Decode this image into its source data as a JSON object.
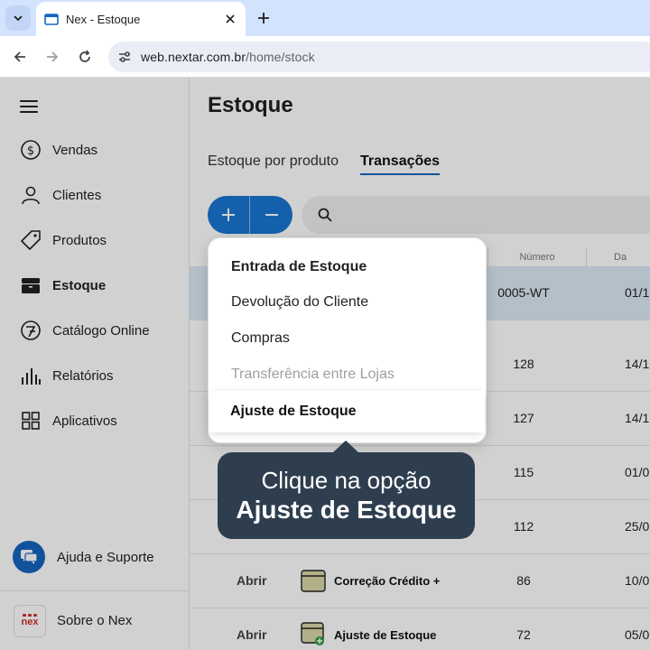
{
  "browser": {
    "tab_title": "Nex - Estoque",
    "url_host": "web.nextar.com.br",
    "url_path": "/home/stock",
    "icons": {
      "dropdown": "chevron-down-icon",
      "favicon": "nex-favicon-icon",
      "close": "close-icon",
      "newtab": "plus-icon",
      "back": "arrow-left-icon",
      "forward": "arrow-right-icon",
      "reload": "reload-icon",
      "siteinfo": "tune-icon"
    }
  },
  "sidebar": {
    "items": [
      {
        "label": "Vendas",
        "icon": "dollar-circle-icon"
      },
      {
        "label": "Clientes",
        "icon": "person-icon"
      },
      {
        "label": "Produtos",
        "icon": "tag-icon"
      },
      {
        "label": "Estoque",
        "icon": "box-icon",
        "active": true
      },
      {
        "label": "Catálogo Online",
        "icon": "catalog-icon"
      },
      {
        "label": "Relatórios",
        "icon": "bar-chart-icon"
      },
      {
        "label": "Aplicativos",
        "icon": "apps-grid-icon"
      }
    ],
    "help_label": "Ajuda e Suporte",
    "about_label": "Sobre o Nex",
    "logo_text": "nex"
  },
  "main": {
    "title": "Estoque",
    "tabs": [
      {
        "label": "Estoque por produto",
        "active": false
      },
      {
        "label": "Transações",
        "active": true
      }
    ],
    "table": {
      "headers": {
        "number": "Número",
        "date": "Da"
      },
      "rows": [
        {
          "open": "",
          "type": "",
          "number": "0005-WT",
          "date": "01/1",
          "highlight": true
        },
        {
          "open": "",
          "type": "",
          "number": "128",
          "date": "14/1"
        },
        {
          "open": "",
          "type": "",
          "number": "127",
          "date": "14/1"
        },
        {
          "open": "",
          "type": "",
          "number": "115",
          "date": "01/0"
        },
        {
          "open": "",
          "type": "",
          "number": "112",
          "date": "25/0"
        },
        {
          "open": "Abrir",
          "type": "Correção Crédito +",
          "number": "86",
          "date": "10/0"
        },
        {
          "open": "Abrir",
          "type": "Ajuste de Estoque",
          "number": "72",
          "date": "05/0"
        }
      ]
    }
  },
  "dropdown": {
    "header": "Entrada de Estoque",
    "items": [
      {
        "label": "Devolução do Cliente",
        "disabled": false
      },
      {
        "label": "Compras",
        "disabled": false
      },
      {
        "label": "Transferência entre Lojas",
        "disabled": true
      }
    ],
    "highlighted": "Ajuste de Estoque"
  },
  "tooltip": {
    "line1": "Clique na opção",
    "line2": "Ajuste de Estoque"
  },
  "colors": {
    "accent": "#1976d2",
    "tooltip_bg": "#2e3e4f",
    "row_highlight": "#dbe9f6",
    "brand_red": "#d32f2f"
  }
}
